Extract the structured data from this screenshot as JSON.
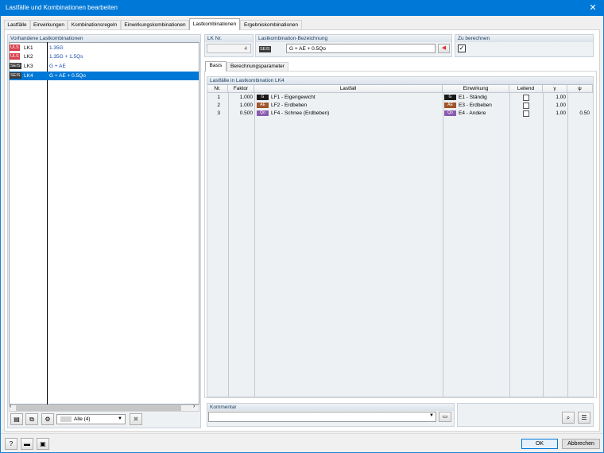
{
  "window": {
    "title": "Lastfälle und Kombinationen bearbeiten",
    "close": "✕"
  },
  "tabs": [
    {
      "label": "Lastfälle"
    },
    {
      "label": "Einwirkungen"
    },
    {
      "label": "Kombinationsregeln"
    },
    {
      "label": "Einwirkungskombinationen"
    },
    {
      "label": "Lastkombinationen"
    },
    {
      "label": "Ergebniskombinationen"
    }
  ],
  "left": {
    "header": "Vorhandene Lastkombinationen",
    "items": [
      {
        "badge": "ULS",
        "name": "LK1",
        "desc": "1.35G",
        "selected": false
      },
      {
        "badge": "ULS",
        "name": "LK2",
        "desc": "1.35G + 1.5Qs",
        "selected": false
      },
      {
        "badge": "SEIS",
        "name": "LK3",
        "desc": "G + AE",
        "selected": false
      },
      {
        "badge": "SEIS",
        "name": "LK4",
        "desc": "G + AE + 0.5Qo",
        "selected": true
      }
    ],
    "filter": "Alle (4)"
  },
  "lk_nr": {
    "label": "LK Nr.",
    "value": "4"
  },
  "bezeichnung": {
    "label": "Lastkombination-Bezeichnung",
    "badge": "SEIS",
    "value": "G + AE + 0.5Qo"
  },
  "zu_berechnen": {
    "label": "Zu berechnen",
    "checked": "✓"
  },
  "inner_tabs": [
    {
      "label": "Basis"
    },
    {
      "label": "Berechnungsparameter"
    }
  ],
  "table": {
    "title": "Lastfälle in Lastkombination LK4",
    "columns": [
      "Nr.",
      "Faktor",
      "Lastfall",
      "Einwirkung",
      "Leitend",
      "γ",
      "ψ"
    ],
    "rows": [
      {
        "nr": "1",
        "faktor": "1.000",
        "lf_chip": "G",
        "lf": "LF1 - Eigengewicht",
        "ew_chip": "G",
        "ew": "E1 - Ständig",
        "gamma": "1.00",
        "psi": ""
      },
      {
        "nr": "2",
        "faktor": "1.000",
        "lf_chip": "AE",
        "lf": "LF2 - Erdbeben",
        "ew_chip": "AE",
        "ew": "E3 - Erdbeben",
        "gamma": "1.00",
        "psi": ""
      },
      {
        "nr": "3",
        "faktor": "0.500",
        "lf_chip": "Qo",
        "lf": "LF4 - Schnee (Erdbeben)",
        "ew_chip": "Qo",
        "ew": "E4 - Andere",
        "gamma": "1.00",
        "psi": "0.50"
      }
    ]
  },
  "comment": {
    "label": "Kommentar",
    "value": ""
  },
  "buttons": {
    "ok": "OK",
    "cancel": "Abbrechen"
  },
  "colors": {
    "accent": "#0078d7",
    "uls": "#d9404c",
    "seis": "#3a3a3a",
    "G": "#1a1a1a",
    "AE": "#a0552a",
    "Qo": "#8a5bb0"
  }
}
